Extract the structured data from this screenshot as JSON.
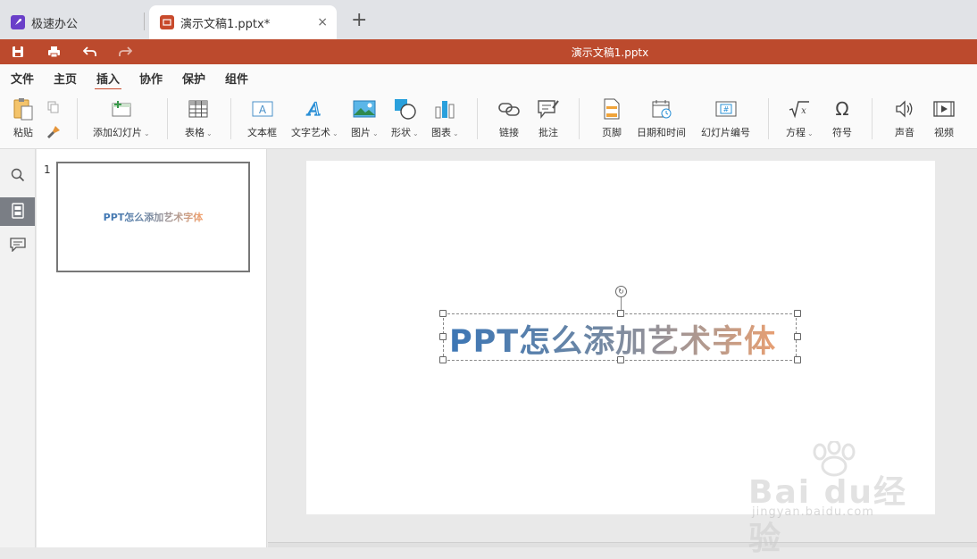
{
  "tabs": {
    "home_label": "极速办公",
    "doc_label": "演示文稿1.pptx*",
    "close_glyph": "×",
    "new_tab_glyph": "+"
  },
  "titlebar": {
    "title": "演示文稿1.pptx",
    "bg_color": "#bc4a2d"
  },
  "menu": [
    {
      "label": "文件"
    },
    {
      "label": "主页"
    },
    {
      "label": "插入"
    },
    {
      "label": "协作"
    },
    {
      "label": "保护"
    },
    {
      "label": "组件"
    }
  ],
  "active_menu": "插入",
  "ribbon": {
    "paste": "粘贴",
    "add_slide": "添加幻灯片",
    "table": "表格",
    "textbox": "文本框",
    "text_art": "文字艺术",
    "image": "图片",
    "shape": "形状",
    "chart": "图表",
    "link": "链接",
    "comment": "批注",
    "footer": "页脚",
    "date_time": "日期和时间",
    "slide_number": "幻灯片编号",
    "equation": "方程",
    "symbol": "符号",
    "audio": "声音",
    "video": "视频",
    "dropdown_glyph": "⌄"
  },
  "slides": {
    "number": "1",
    "thumb_text": "PPT怎么添加艺术字体"
  },
  "slide": {
    "art_text": "PPT怎么添加艺术字体"
  },
  "watermark": {
    "main": "Bai du经验",
    "sub": "jingyan.baidu.com"
  }
}
